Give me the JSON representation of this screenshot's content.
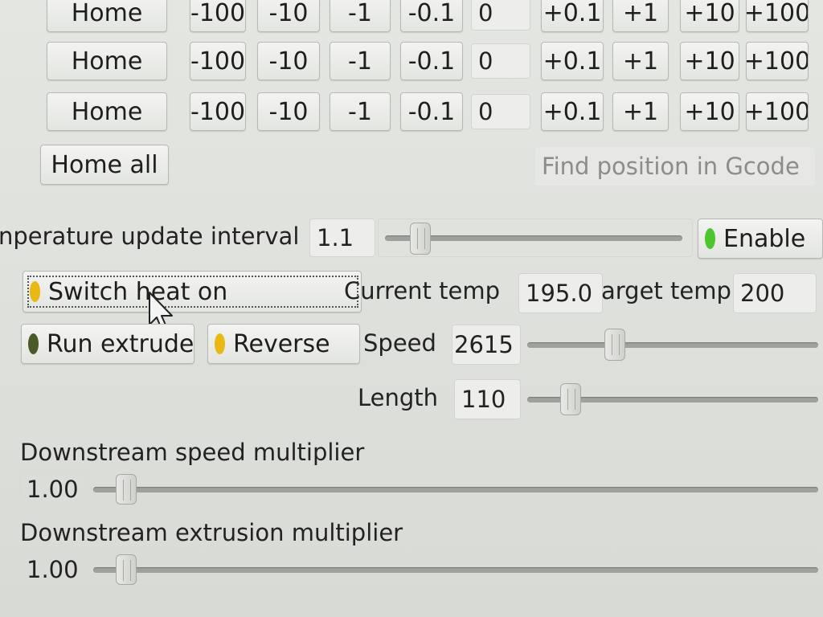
{
  "jog": {
    "rows": [
      {
        "home": "Home",
        "steps": [
          "-100",
          "-10",
          "-1",
          "-0.1"
        ],
        "value": "0",
        "steps_plus": [
          "+0.1",
          "+1",
          "+10",
          "+100"
        ]
      },
      {
        "home": "Home",
        "steps": [
          "-100",
          "-10",
          "-1",
          "-0.1"
        ],
        "value": "0",
        "steps_plus": [
          "+0.1",
          "+1",
          "+10",
          "+100"
        ]
      },
      {
        "home": "Home",
        "steps": [
          "-100",
          "-10",
          "-1",
          "-0.1"
        ],
        "value": "0",
        "steps_plus": [
          "+0.1",
          "+1",
          "+10",
          "+100"
        ]
      }
    ],
    "home_all": "Home all",
    "find_position": "Find position in Gcode"
  },
  "temperature": {
    "interval_label": "nperature update interval",
    "interval_value": "1.1",
    "interval_slider_fraction": 0.12,
    "enable_label": "Enable",
    "enable_led_color": "#4cc52e",
    "switch_heat_label": "Switch heat on",
    "switch_heat_led_color": "#e8b814",
    "current_temp_label": "Current temp",
    "current_temp_value": "195.0",
    "target_temp_label": "arget temp",
    "target_temp_value": "200"
  },
  "extruder": {
    "run_label": "Run extrude",
    "run_led_color": "#4a5a28",
    "reverse_label": "Reverse",
    "reverse_led_color": "#e8b814",
    "speed_label": "Speed",
    "speed_value": "2615",
    "speed_slider_fraction": 0.3,
    "length_label": "Length",
    "length_value": "110",
    "length_slider_fraction": 0.15
  },
  "downstream": {
    "speed_label": "Downstream speed multiplier",
    "speed_value": "1.00",
    "extrusion_label": "Downstream extrusion multiplier",
    "extrusion_value": "1.00"
  }
}
